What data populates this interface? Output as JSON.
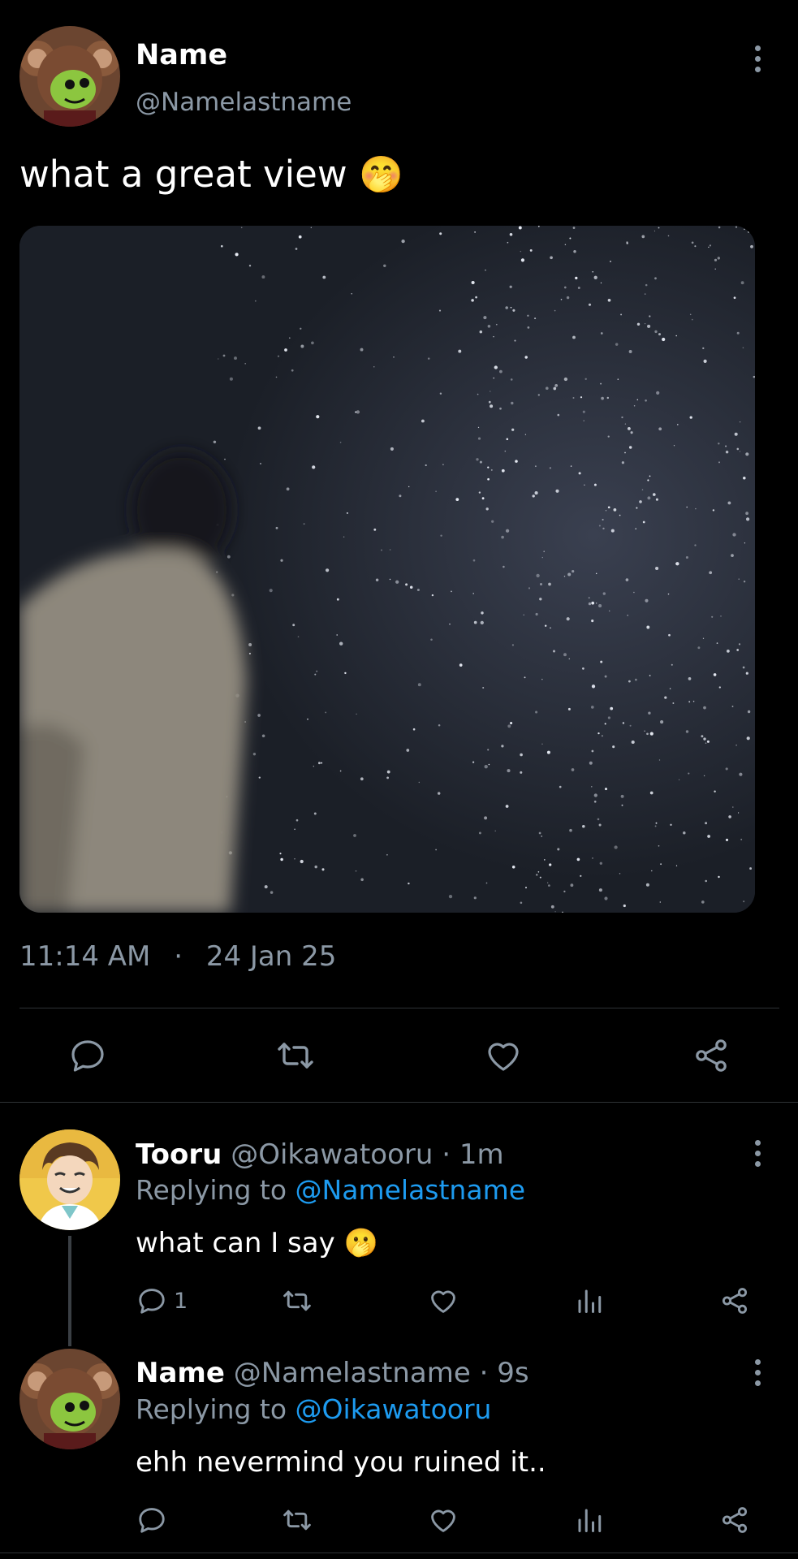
{
  "main_tweet": {
    "author_name": "Name",
    "author_handle": "@Namelastname",
    "text": "what a great view",
    "emoji": "🤭",
    "time": "11:14 AM",
    "separator": "·",
    "date": "24 Jan 25"
  },
  "replies": [
    {
      "author_name": "Tooru",
      "author_handle": "@Oikawatooru",
      "age": "· 1m",
      "replying_prefix": "Replying to",
      "replying_to": "@Namelastname",
      "text": "what can I say",
      "emoji": "🫢",
      "reply_count": "1"
    },
    {
      "author_name": "Name",
      "author_handle": "@Namelastname",
      "age": "· 9s",
      "replying_prefix": "Replying to",
      "replying_to": "@Oikawatooru",
      "text": "ehh nevermind you ruined it.."
    }
  ],
  "colors": {
    "background": "#000000",
    "secondary_text": "#8b98a5",
    "link": "#1d9bf0",
    "divider": "#2f3336"
  },
  "icons": [
    "more-vertical-icon",
    "reply-icon",
    "retweet-icon",
    "like-icon",
    "share-icon",
    "views-icon"
  ]
}
